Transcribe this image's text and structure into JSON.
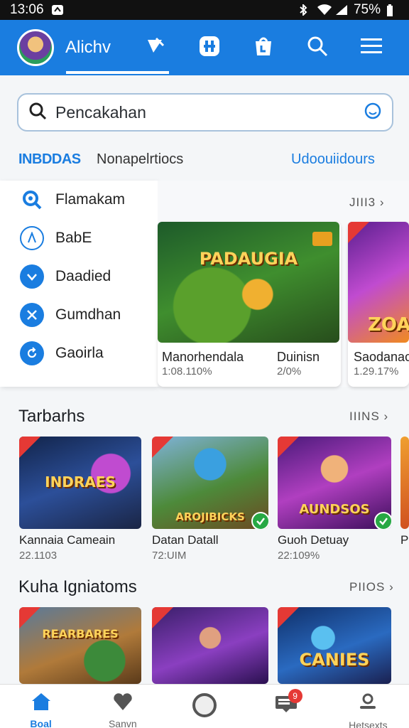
{
  "status_bar": {
    "time": "13:06",
    "battery_text": "75%"
  },
  "header": {
    "title": "Alichv"
  },
  "search": {
    "value": "Pencakahan"
  },
  "tabs": [
    {
      "label": "INBDDAS"
    },
    {
      "label": "Nonapelrtiocs"
    },
    {
      "label": "Udoouiidours"
    }
  ],
  "sidebar": {
    "items": [
      {
        "label": "Flamakam",
        "icon": "search-icon"
      },
      {
        "label": "BabE",
        "icon": "compass-icon"
      },
      {
        "label": "Daadied",
        "icon": "check-icon"
      },
      {
        "label": "Gumdhan",
        "icon": "swords-icon"
      },
      {
        "label": "Gaoirla",
        "icon": "refresh-icon"
      }
    ]
  },
  "featured": {
    "more_label": "JIII3",
    "cards": [
      {
        "title": "Manorhendala",
        "sub": "1:08.110%",
        "title2": "Duinisn",
        "sub2": "2/0%",
        "art_text": "PADAUGIA"
      },
      {
        "title": "Saodanac",
        "sub": "1.29.17%",
        "art_text": "ZOA"
      }
    ]
  },
  "sections": [
    {
      "title": "Tarbarhs",
      "more_label": "IIINS",
      "cards": [
        {
          "title": "Kannaia Cameain",
          "sub": "22.1103",
          "art_text": "INDRAES"
        },
        {
          "title": "Datan Datall",
          "sub": "72:UIM",
          "art_text": "AROJIBICKS"
        },
        {
          "title": "Guoh Detuay",
          "sub": "22:109%",
          "art_text": "AUNDSOS"
        },
        {
          "title": "Pa",
          "sub": ""
        }
      ]
    },
    {
      "title": "Kuha Igniatoms",
      "more_label": "PIIOS",
      "cards": [
        {
          "title": "",
          "sub": "",
          "art_text": "REARBARES"
        },
        {
          "title": "",
          "sub": "",
          "art_text": ""
        },
        {
          "title": "",
          "sub": "",
          "art_text": "CANIES"
        }
      ]
    }
  ],
  "bottom_nav": {
    "items": [
      {
        "label": "Boal"
      },
      {
        "label": "Sanvn"
      },
      {
        "label": ""
      },
      {
        "label": "",
        "badge": "9"
      },
      {
        "label": "Hetsexts"
      }
    ]
  },
  "colors": {
    "primary": "#1a7de0",
    "success": "#27a844",
    "badge": "#e53935"
  }
}
